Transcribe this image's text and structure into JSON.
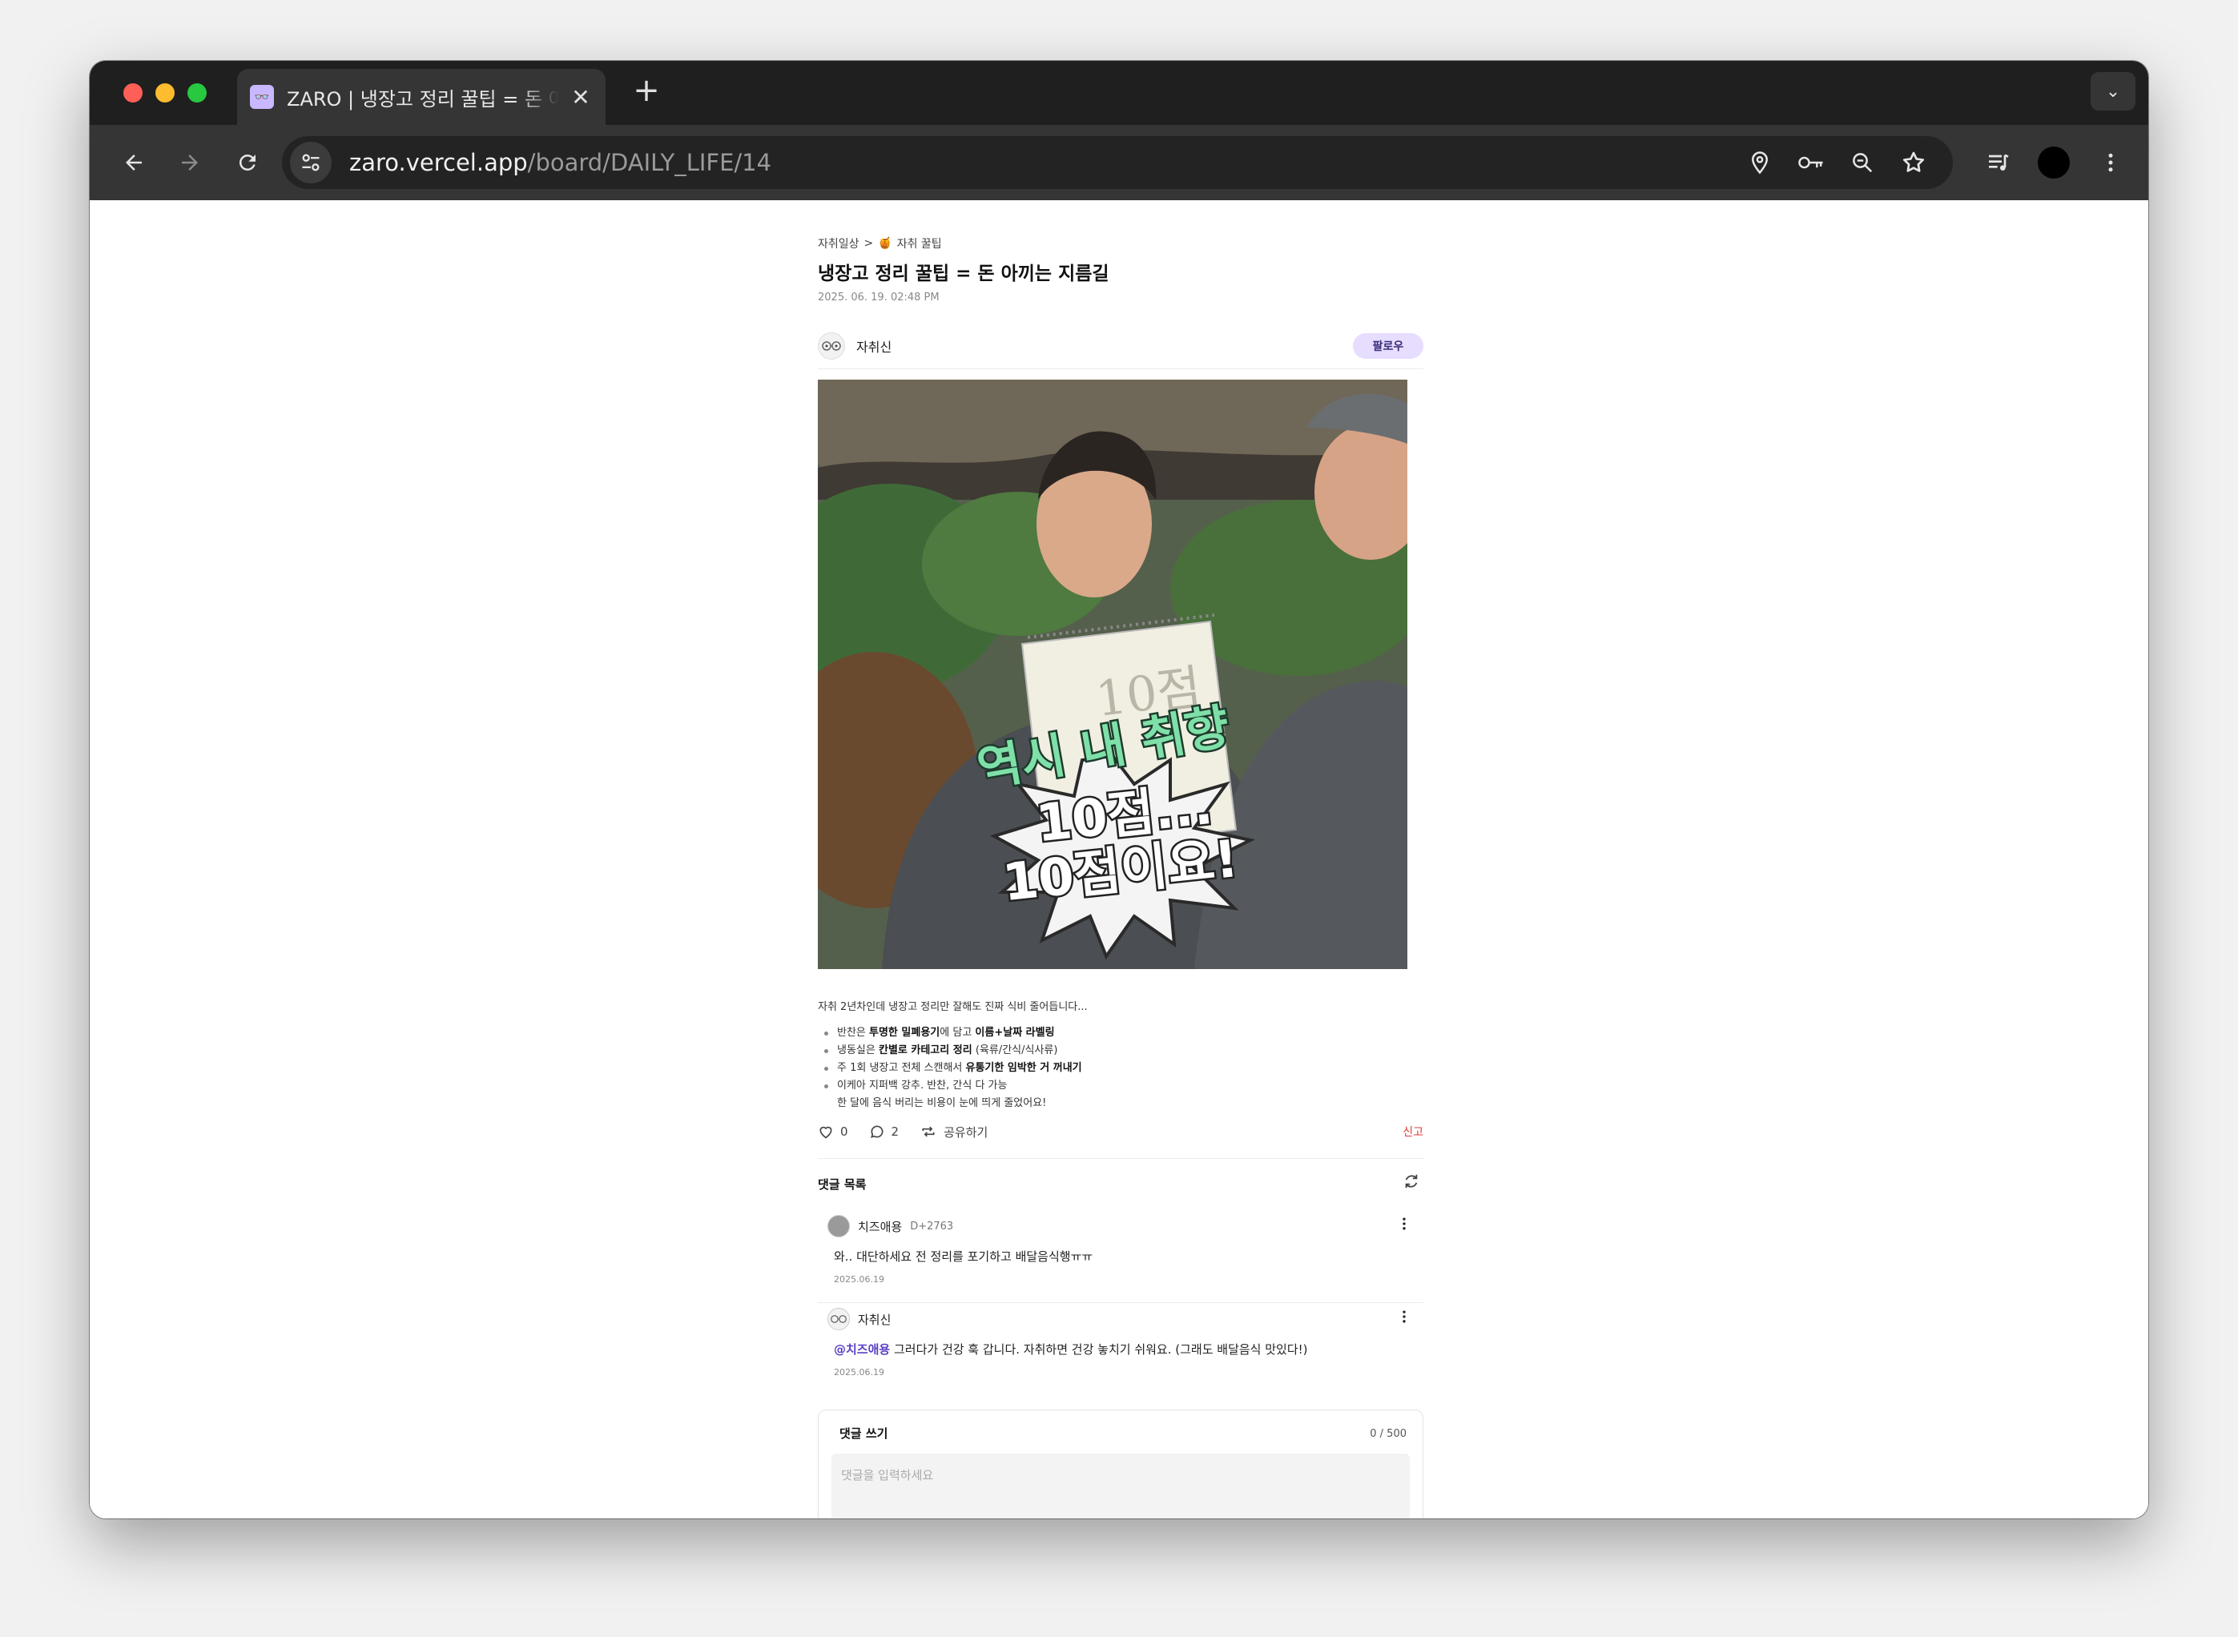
{
  "browser": {
    "tab_title": "ZARO | 냉장고 정리 꿀팁 = 돈 아끼는 지름길",
    "tab_favicon": "👓",
    "tab_close": "✕",
    "new_tab": "+",
    "tab_menu": "⌄",
    "url_host": "zaro.vercel.app",
    "url_path": "/board/DAILY_LIFE/14"
  },
  "post": {
    "breadcrumb_board": "자취일상",
    "breadcrumb_separator": ">",
    "breadcrumb_category_emoji": "🍯",
    "breadcrumb_category": "자취 꿀팁",
    "title": "냉장고 정리 꿀팁 = 돈 아끼는 지름길",
    "date": "2025. 06. 19. 02:48 PM",
    "author": "자취신",
    "follow_label": "팔로우",
    "image_caption_line1": "역시 내 취향",
    "image_caption_line2": "10점...",
    "image_caption_line3": "10점이요!",
    "image_board_text": "10점",
    "intro": "자취 2년차인데 냉장고 정리만 잘해도 진짜 식비 줄어듭니다...",
    "list": [
      {
        "pre": "반찬은 ",
        "b1": "투명한 밀폐용기",
        "mid": "에 담고 ",
        "b2": "이름+날짜 라벨링",
        "post": ""
      },
      {
        "pre": "냉동실은 ",
        "b1": "칸별로 카테고리 정리",
        "mid": " (육류/간식/식사류)",
        "b2": "",
        "post": ""
      },
      {
        "pre": "주 1회 냉장고 전체 스캔해서 ",
        "b1": "유통기한 임박한 거 꺼내기",
        "mid": "",
        "b2": "",
        "post": ""
      },
      {
        "pre": "이케아 지퍼백 강추. 반찬, 간식 다 가능",
        "b1": "",
        "mid": "",
        "b2": "",
        "post": ""
      }
    ],
    "extra_line": "한 달에 음식 버리는 비용이 눈에 띄게 줄었어요!",
    "likes": "0",
    "comments_count": "2",
    "share_label": "공유하기",
    "report_label": "신고"
  },
  "comments": {
    "title": "댓글 목록",
    "items": [
      {
        "author": "치즈애용",
        "dday": "D+2763",
        "mention": "",
        "text": "와.. 대단하세요 전 정리를 포기하고 배달음식행ㅠㅠ",
        "date": "2025.06.19"
      },
      {
        "author": "자취신",
        "dday": "",
        "mention": "@치즈애용",
        "text": " 그러다가 건강 훅 갑니다. 자취하면 건강 놓치기 쉬워요. (그래도 배달음식 맛있다!)",
        "date": "2025.06.19"
      }
    ],
    "write_title": "댓글 쓰기",
    "write_count": "0 / 500",
    "write_placeholder": "댓글을 입력하세요"
  },
  "icons": {
    "back": "back-arrow-icon",
    "forward": "forward-arrow-icon",
    "reload": "reload-icon",
    "site_info": "tune-icon",
    "location": "location-pin-icon",
    "key": "key-icon",
    "zoom": "zoom-out-icon",
    "star": "star-icon",
    "media": "media-controls-icon",
    "menu": "kebab-menu-icon",
    "heart": "heart-icon",
    "comment": "comment-bubble-icon",
    "share": "repost-icon",
    "refresh": "refresh-icon"
  },
  "colors": {
    "accent_purple": "#5b3fc4",
    "follow_bg": "#e6ddff",
    "report_red": "#e03b3b",
    "caption_green": "#7ee0a8"
  }
}
